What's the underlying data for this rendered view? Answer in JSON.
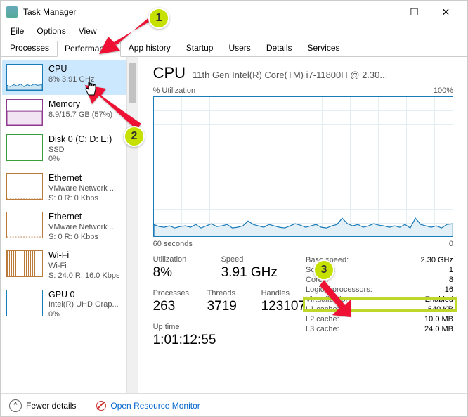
{
  "window": {
    "title": "Task Manager"
  },
  "menu": {
    "file": "File",
    "options": "Options",
    "view": "View"
  },
  "tabs": {
    "processes": "Processes",
    "performance": "Performance",
    "app_history": "App history",
    "startup": "Startup",
    "users": "Users",
    "details": "Details",
    "services": "Services"
  },
  "sidebar": [
    {
      "name": "CPU",
      "sub": "8% 3.91 GHz",
      "color": "#1a7bb9"
    },
    {
      "name": "Memory",
      "sub": "8.9/15.7 GB (57%)",
      "color": "#8e3a8e"
    },
    {
      "name": "Disk 0 (C: D: E:)",
      "sub1": "SSD",
      "sub2": "0%",
      "color": "#3a9e3a"
    },
    {
      "name": "Ethernet",
      "sub1": "VMware Network ...",
      "sub2": "S: 0  R: 0 Kbps",
      "color": "#b97a3a"
    },
    {
      "name": "Ethernet",
      "sub1": "VMware Network ...",
      "sub2": "S: 0  R: 0 Kbps",
      "color": "#b97a3a"
    },
    {
      "name": "Wi-Fi",
      "sub1": "Wi-Fi",
      "sub2": "S: 24.0  R: 16.0 Kbps",
      "color": "#b97a3a"
    },
    {
      "name": "GPU 0",
      "sub1": "Intel(R) UHD Grap...",
      "sub2": "0%",
      "color": "#1a7bb9"
    }
  ],
  "main": {
    "heading": "CPU",
    "desc": "11th Gen Intel(R) Core(TM) i7-11800H @ 2.30...",
    "chart_top_left": "% Utilization",
    "chart_top_right": "100%",
    "chart_bot_left": "60 seconds",
    "chart_bot_right": "0",
    "stats": {
      "utilization": {
        "label": "Utilization",
        "value": "8%"
      },
      "speed": {
        "label": "Speed",
        "value": "3.91 GHz"
      },
      "processes": {
        "label": "Processes",
        "value": "263"
      },
      "threads": {
        "label": "Threads",
        "value": "3719"
      },
      "handles": {
        "label": "Handles",
        "value": "123107"
      },
      "uptime": {
        "label": "Up time",
        "value": "1:01:12:55"
      }
    },
    "right": [
      {
        "k": "Base speed:",
        "v": "2.30 GHz"
      },
      {
        "k": "Sockets:",
        "v": "1"
      },
      {
        "k": "Cores:",
        "v": "8"
      },
      {
        "k": "Logical processors:",
        "v": "16"
      },
      {
        "k": "Virtualization:",
        "v": "Enabled"
      },
      {
        "k": "L1 cache:",
        "v": "640 KB"
      },
      {
        "k": "L2 cache:",
        "v": "10.0 MB"
      },
      {
        "k": "L3 cache:",
        "v": "24.0 MB"
      }
    ]
  },
  "footer": {
    "fewer": "Fewer details",
    "orm": "Open Resource Monitor"
  },
  "annotations": {
    "b1": "1",
    "b2": "2",
    "b3": "3"
  },
  "chart_data": {
    "type": "line",
    "title": "% Utilization",
    "xlabel": "60 seconds",
    "ylabel": "%",
    "ylim": [
      0,
      100
    ],
    "xrange_seconds": [
      60,
      0
    ],
    "values_pct": [
      10,
      8,
      7,
      8,
      6,
      7,
      8,
      7,
      9,
      6,
      8,
      10,
      7,
      8,
      9,
      6,
      7,
      8,
      12,
      9,
      8,
      7,
      9,
      8,
      7,
      6,
      8,
      10,
      9,
      7,
      8,
      9,
      7,
      6,
      8,
      9,
      14,
      10,
      8,
      9,
      7,
      8,
      10,
      9,
      8,
      7,
      8,
      7,
      9,
      6,
      14,
      9,
      8,
      7,
      8,
      6,
      9,
      7,
      8,
      10
    ]
  }
}
